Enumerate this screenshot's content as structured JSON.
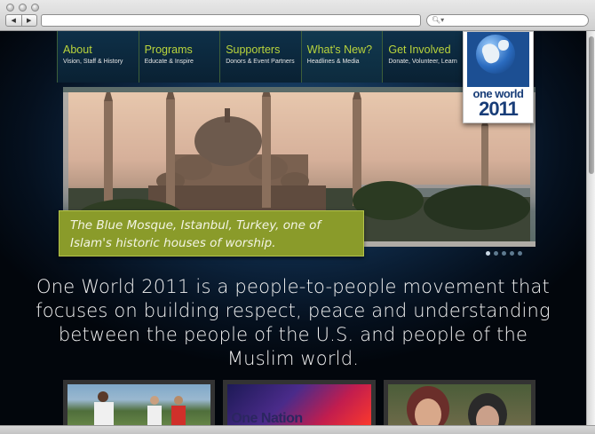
{
  "browser": {
    "back_icon": "back-arrow-icon",
    "forward_icon": "forward-arrow-icon",
    "url": "",
    "search_icon": "magnifier-icon"
  },
  "nav": {
    "items": [
      {
        "title": "About",
        "subtitle": "Vision, Staff & History"
      },
      {
        "title": "Programs",
        "subtitle": "Educate & Inspire"
      },
      {
        "title": "Supporters",
        "subtitle": "Donors & Event Partners"
      },
      {
        "title": "What's New?",
        "subtitle": "Headlines & Media"
      },
      {
        "title": "Get Involved",
        "subtitle": "Donate, Volunteer, Learn"
      }
    ]
  },
  "logo": {
    "line1": "one world",
    "line2": "2011"
  },
  "hero": {
    "caption": "The Blue Mosque, Istanbul, Turkey, one of Islam's historic houses of worship.",
    "slide_count": 5,
    "active_slide": 1
  },
  "mission": "One World 2011 is a people-to-people movement that focuses on building respect, peace and understanding between the people of the U.S. and people of the Muslim world.",
  "thumbnails": [
    {
      "name": "players-photo",
      "text": ""
    },
    {
      "name": "one-nation-graphic",
      "text": "One Nation"
    },
    {
      "name": "women-photo",
      "text": ""
    }
  ],
  "colors": {
    "accent_green": "#b9d43c",
    "caption_bg": "#8a9b2a",
    "logo_blue": "#183d78",
    "background_dark": "#05101e"
  }
}
